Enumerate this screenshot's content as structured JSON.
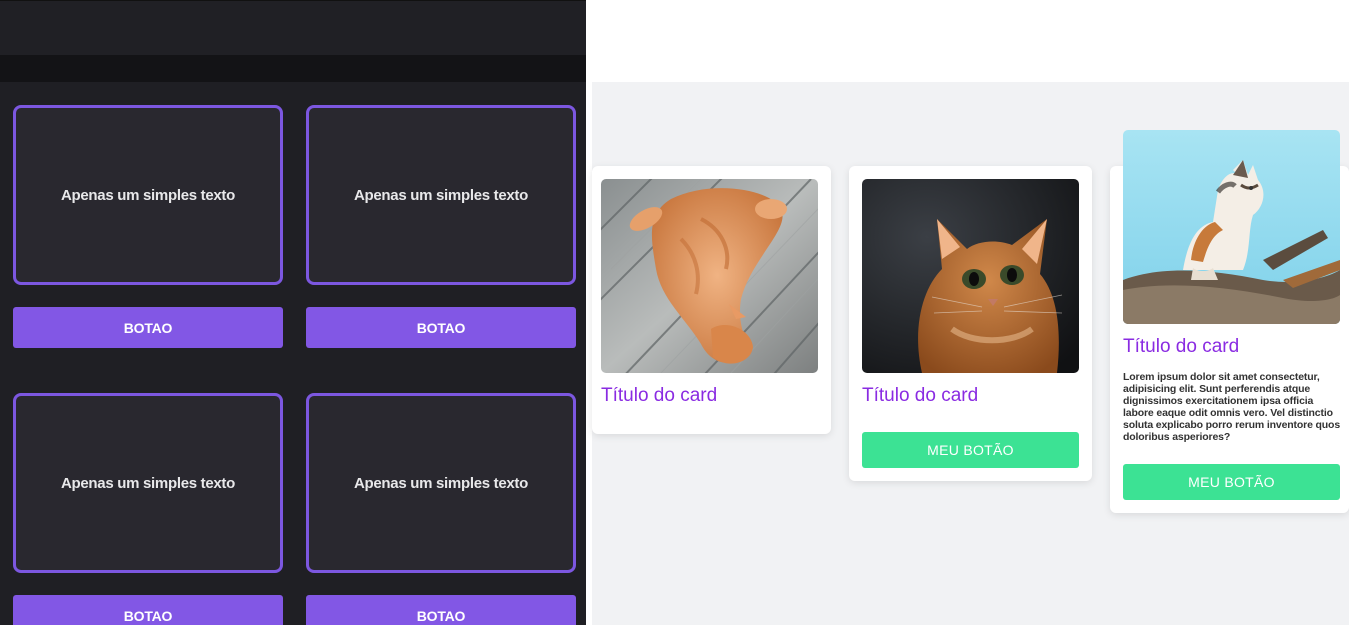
{
  "left_panel": {
    "boxes": [
      {
        "text": "Apenas um simples texto",
        "button": "BOTAO"
      },
      {
        "text": "Apenas um simples texto",
        "button": "BOTAO"
      },
      {
        "text": "Apenas um simples texto",
        "button": "BOTAO"
      },
      {
        "text": "Apenas um simples texto",
        "button": "BOTAO"
      }
    ],
    "colors": {
      "border": "#7c57e0",
      "button": "#8257e5",
      "background": "#1f1f24"
    }
  },
  "cards": [
    {
      "image": "orange-cat-lying-on-wood",
      "title": "Título do card"
    },
    {
      "image": "orange-cat-looking-up",
      "title": "Título do card",
      "button": "MEU BOTÃO"
    },
    {
      "image": "calico-cat-on-branch",
      "title": "Título do card",
      "text": "Lorem ipsum dolor sit amet consectetur, adipisicing elit. Sunt perferendis atque dignissimos exercitationem ipsa officia labore eaque odit omnis vero. Vel distinctio soluta explicabo porro rerum inventore quos doloribus asperiores?",
      "button": "MEU BOTÃO"
    }
  ],
  "colors": {
    "card_title": "#8a2be2",
    "card_button": "#3ce294"
  }
}
